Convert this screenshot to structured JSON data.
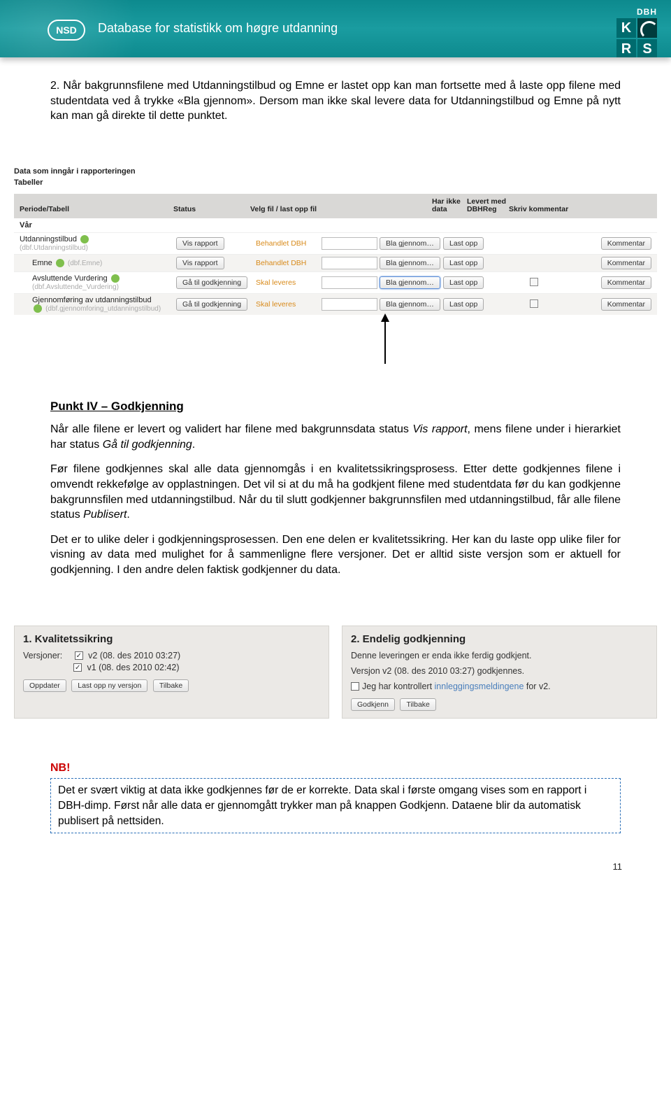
{
  "banner": {
    "nsd_label": "NSD",
    "title": "Database for statistikk om høgre utdanning",
    "dbh_label": "DBH",
    "kurs_letters": [
      "K",
      "U",
      "R",
      "S"
    ]
  },
  "para1": "2. Når bakgrunnsfilene med Utdanningstilbud og Emne er lastet opp kan man fortsette med å laste opp filene med studentdata ved å trykke «Bla gjennom». Dersom man ikke skal levere data for Utdanningstilbud og Emne på nytt kan man gå direkte til dette punktet.",
  "shot1": {
    "title": "Data som inngår i rapporteringen",
    "subtitle": "Tabeller",
    "columns": {
      "c1": "Periode/Tabell",
      "c2": "Status",
      "c3": "Velg fil / last opp fil",
      "c4": "Har ikke data",
      "c5": "Levert med DBHReg",
      "c6": "Skriv kommentar"
    },
    "section": "Vår",
    "btn_vis": "Vis rapport",
    "btn_godkj": "Gå til godkjenning",
    "status_behandlet": "Behandlet DBH",
    "status_skal": "Skal leveres",
    "btn_bla": "Bla gjennom…",
    "btn_last": "Last opp",
    "btn_komm": "Kommentar",
    "rows": [
      {
        "name": "Utdanningstilbud",
        "sub": "(dbf.Utdanningstilbud)",
        "mode": "vis",
        "status": "behandlet",
        "chk": false
      },
      {
        "name": "Emne",
        "sub": "(dbf.Emne)",
        "mode": "vis",
        "status": "behandlet",
        "chk": false
      },
      {
        "name": "Avsluttende Vurdering",
        "sub": "(dbf.Avsluttende_Vurdering)",
        "mode": "godkj",
        "status": "skal",
        "chk": true
      },
      {
        "name": "Gjennomføring av utdanningstilbud",
        "sub": "(dbf.gjennomforing_utdanningstilbud)",
        "mode": "godkj",
        "status": "skal",
        "chk": true
      }
    ]
  },
  "heading_iv": "Punkt IV – Godkjenning",
  "para2a": "Når alle filene er levert og validert har filene med bakgrunnsdata status ",
  "para2_vis": "Vis rapport",
  "para2b": ", mens filene under i hierarkiet har status ",
  "para2_ga": "Gå til godkjenning",
  "para2c": ".",
  "para3": "Før filene godkjennes skal alle data gjennomgås i en kvalitetssikringsprosess. Etter dette godkjennes filene i omvendt rekkefølge av opplastningen. Det vil si at du må ha godkjent filene med studentdata før du kan godkjenne bakgrunnsfilen med utdanningstilbud. Når du til slutt godkjenner bakgrunnsfilen med utdanningstilbud, får alle filene status ",
  "para3_pub": "Publisert",
  "para3b": ".",
  "para4": "Det er to ulike deler i godkjenningsprosessen. Den ene delen er kvalitetssikring. Her kan du laste opp ulike filer for visning av data med mulighet for å sammenligne flere versjoner. Det er alltid siste versjon som er aktuell for godkjenning. I den andre delen faktisk godkjenner du data.",
  "panels": {
    "p1": {
      "title": "1. Kvalitetssikring",
      "versjoner_label": "Versjoner:",
      "v2": "v2 (08. des 2010 03:27)",
      "v1": "v1 (08. des 2010 02:42)",
      "btn_oppdater": "Oppdater",
      "btn_lastny": "Last opp ny versjon",
      "btn_tilbake": "Tilbake"
    },
    "p2": {
      "title": "2. Endelig godkjenning",
      "line1": "Denne leveringen er enda ikke ferdig godkjent.",
      "line2": "Versjon v2 (08. des 2010 03:27) godkjennes.",
      "line3a": "Jeg har kontrollert ",
      "line3_link": "innleggingsmeldingene",
      "line3b": " for v2.",
      "btn_godkjenn": "Godkjenn",
      "btn_tilbake": "Tilbake"
    }
  },
  "nb_label": "NB!",
  "nb_text": "Det er svært viktig at data ikke godkjennes før de er korrekte. Data skal i første omgang vises som en rapport i DBH-dimp. Først når alle data er gjennomgått trykker man på knappen Godkjenn. Dataene blir da automatisk publisert på nettsiden.",
  "page_number": "11"
}
